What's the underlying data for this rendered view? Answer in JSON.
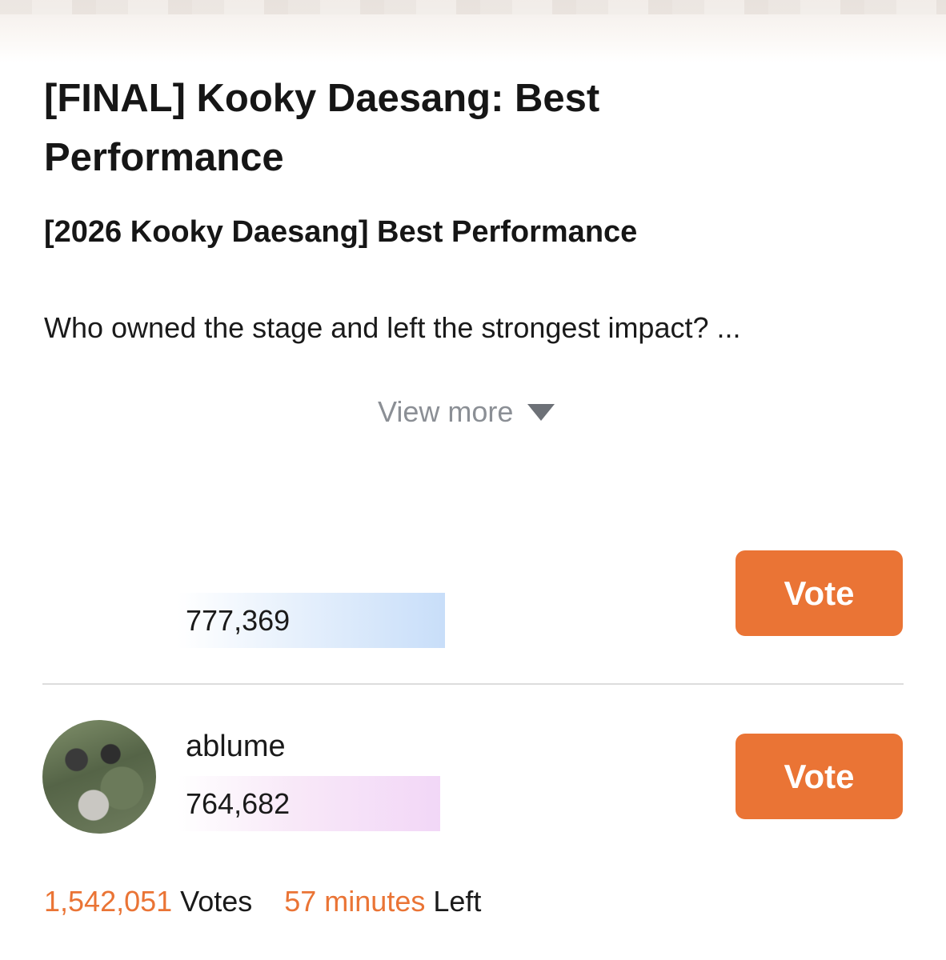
{
  "poll": {
    "title": "[FINAL] Kooky Daesang: Best Performance",
    "subtitle": "[2026 Kooky Daesang] Best Performance",
    "description": "Who owned the stage and left the strongest impact? ...",
    "view_more_label": "View more"
  },
  "candidates": [
    {
      "name": "",
      "votes": "777,369",
      "vote_label": "Vote",
      "bar_color": "#c8def9"
    },
    {
      "name": "ablume",
      "votes": "764,682",
      "vote_label": "Vote",
      "bar_color": "#f2d7f7"
    }
  ],
  "footer": {
    "total_votes": "1,542,051",
    "votes_label": "Votes",
    "time_left": "57 minutes",
    "left_label": "Left"
  },
  "colors": {
    "accent": "#ea7435",
    "text": "#1a1a1a",
    "muted": "#8b8f95"
  },
  "icons": {
    "view_more": "caret-down-icon"
  }
}
